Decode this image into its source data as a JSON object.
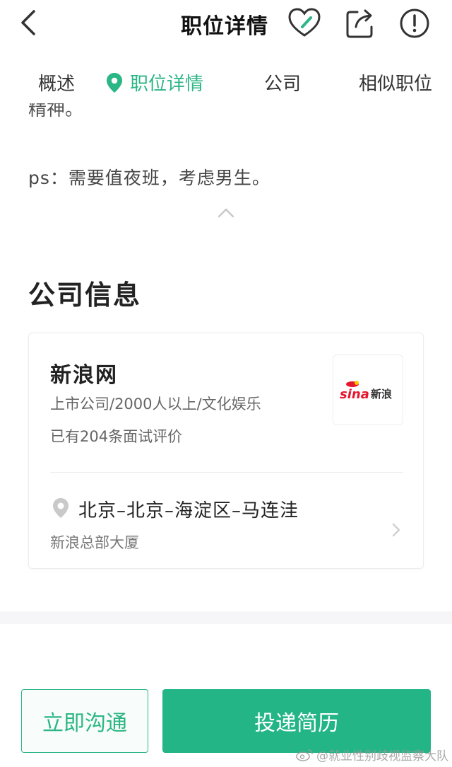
{
  "header": {
    "title": "职位详情",
    "icons": [
      "back-icon",
      "heart-icon",
      "share-icon",
      "report-icon"
    ]
  },
  "tabs": [
    {
      "label": "概述",
      "active": false
    },
    {
      "label": "职位详情",
      "active": true
    },
    {
      "label": "公司",
      "active": false
    },
    {
      "label": "相似职位",
      "active": false
    }
  ],
  "job": {
    "cut_text": "精神。",
    "note": "ps：需要值夜班，考虑男生。"
  },
  "company_section": {
    "title": "公司信息",
    "name": "新浪网",
    "meta": "上市公司/2000人以上/文化娱乐",
    "reviews": "已有204条面试评价",
    "logo_text": "sina新浪",
    "address": "北京–北京–海淀区–马连洼",
    "building": "新浪总部大厦"
  },
  "actions": {
    "chat_label": "立即沟通",
    "apply_label": "投递简历"
  },
  "watermark": "@就业性别歧视监察大队",
  "colors": {
    "accent": "#2bb685",
    "sina_red": "#e6162d"
  }
}
